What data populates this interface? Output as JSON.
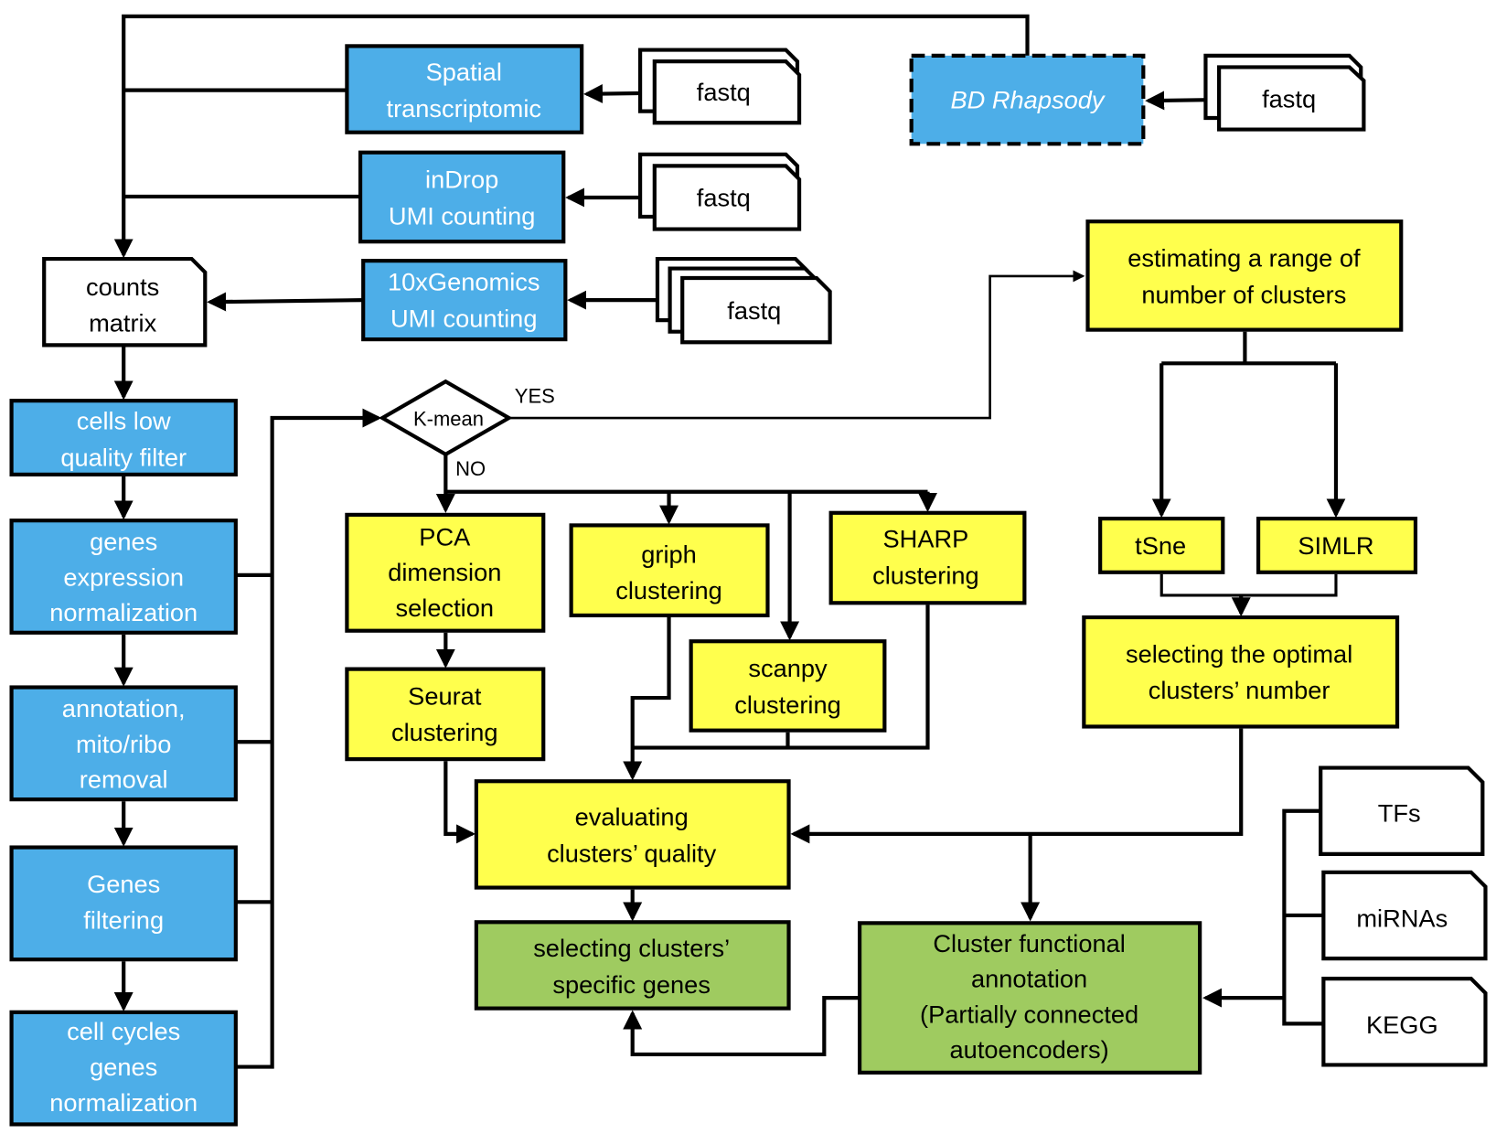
{
  "colors": {
    "input_platform": "#4DAEE8",
    "clustering": "#FFFF4D",
    "annotation": "#9FCB60",
    "data_file": "#FFFFFF"
  },
  "inputs": {
    "spatial": [
      "Spatial",
      "transcriptomic"
    ],
    "indrop": [
      "inDrop",
      "UMI counting"
    ],
    "tenx": [
      "10xGenomics",
      "UMI counting"
    ],
    "bd": [
      "BD Rhapsody"
    ],
    "fastq": "fastq"
  },
  "counts_matrix": [
    "counts",
    "matrix"
  ],
  "preprocessing": [
    [
      "cells low",
      "quality filter"
    ],
    [
      "genes",
      "expression",
      "normalization"
    ],
    [
      "annotation,",
      "mito/ribo",
      "removal"
    ],
    [
      "Genes",
      "filtering"
    ],
    [
      "cell cycles",
      "genes",
      "normalization"
    ]
  ],
  "decision": {
    "label": "K-mean",
    "yes": "YES",
    "no": "NO"
  },
  "clustering": {
    "pca": [
      "PCA",
      "dimension",
      "selection"
    ],
    "seurat": [
      "Seurat",
      "clustering"
    ],
    "griph": [
      "griph",
      "clustering"
    ],
    "scanpy": [
      "scanpy",
      "clustering"
    ],
    "sharp": [
      "SHARP",
      "clustering"
    ],
    "estimating": [
      "estimating a range of",
      "number of clusters"
    ],
    "tsne": [
      "tSne"
    ],
    "simlr": [
      "SIMLR"
    ],
    "optimal": [
      "selecting the optimal",
      "clusters’ number"
    ],
    "evaluating": [
      "evaluating",
      "clusters’ quality"
    ]
  },
  "annotation": {
    "specific_genes": [
      "selecting clusters’",
      "specific genes"
    ],
    "functional": [
      "Cluster functional",
      "annotation",
      "(Partially connected",
      "autoencoders)"
    ]
  },
  "databases": [
    "TFs",
    "miRNAs",
    "KEGG"
  ]
}
